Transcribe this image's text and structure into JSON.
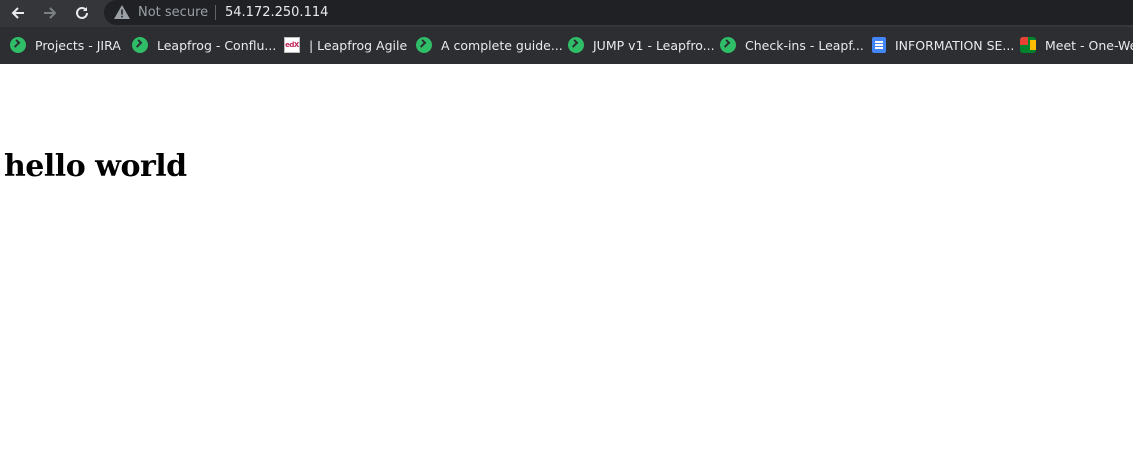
{
  "browser": {
    "address_bar": {
      "security_label": "Not secure",
      "url": "54.172.250.114"
    },
    "bookmarks": [
      {
        "label": "Projects - JIRA",
        "icon": "leapfrog-icon"
      },
      {
        "label": "Leapfrog - Conflu...",
        "icon": "leapfrog-icon"
      },
      {
        "label": "| Leapfrog Agile",
        "icon": "edx-icon"
      },
      {
        "label": "A complete guide...",
        "icon": "leapfrog-icon"
      },
      {
        "label": "JUMP v1 - Leapfro...",
        "icon": "leapfrog-icon"
      },
      {
        "label": "Check-ins - Leapf...",
        "icon": "leapfrog-icon"
      },
      {
        "label": "INFORMATION SE...",
        "icon": "google-docs-icon"
      },
      {
        "label": "Meet - One-Wee",
        "icon": "google-meet-icon"
      }
    ],
    "colors": {
      "chrome_bg": "#35363a",
      "omnibox_bg": "#202124",
      "leapfrog_green": "#2fbd68"
    }
  },
  "page": {
    "heading": "hello world"
  }
}
